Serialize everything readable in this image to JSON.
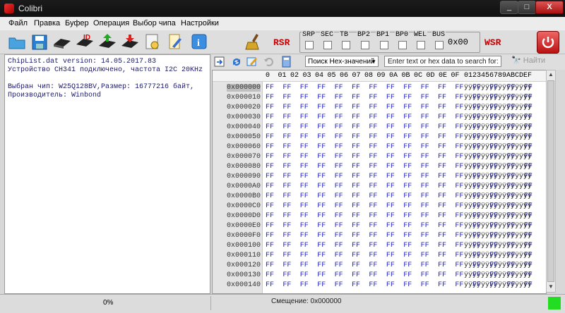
{
  "window": {
    "title": "Colibri",
    "min": "_",
    "max": "□",
    "close": "X"
  },
  "menu": [
    "Файл",
    "Правка",
    "Буфер",
    "Операция",
    "Выбор чипа",
    "Настройки"
  ],
  "registers": {
    "rsr_label": "RSR",
    "wsr_label": "WSR",
    "value": "0x00",
    "bits": [
      "SRP",
      "SEC",
      "TB",
      "BP2",
      "BP1",
      "BP0",
      "WEL",
      "BUS"
    ]
  },
  "log": [
    "ChipList.dat version: 14.05.2017.83",
    "Устройство CH341 подключено, частота I2C 20KHz",
    "",
    "Выбран чип: W25Q128BV,Размер: 16777216 байт,",
    "Производитель: Winbond"
  ],
  "hex_tools": {
    "search_mode": "Поиск Hex-значений",
    "search_placeholder": "Enter text or hex data to search for:",
    "find_label": "Найти"
  },
  "hex_header": {
    "columns": [
      "0",
      "01",
      "02",
      "03",
      "04",
      "05",
      "06",
      "07",
      "08",
      "09",
      "0A",
      "0B",
      "0C",
      "0D",
      "0E",
      "0F"
    ],
    "ascii_header": "0123456789ABCDEF"
  },
  "hex_rows": [
    {
      "addr": "0x000000",
      "bytes": "FF FF FF FF FF FF FF FF FF FF FF FF FF FF FF FF",
      "ascii": "ÿÿÿÿÿÿÿÿÿÿÿÿÿÿÿÿ"
    },
    {
      "addr": "0x000010",
      "bytes": "FF FF FF FF FF FF FF FF FF FF FF FF FF FF FF FF",
      "ascii": "ÿÿÿÿÿÿÿÿÿÿÿÿÿÿÿÿ"
    },
    {
      "addr": "0x000020",
      "bytes": "FF FF FF FF FF FF FF FF FF FF FF FF FF FF FF FF",
      "ascii": "ÿÿÿÿÿÿÿÿÿÿÿÿÿÿÿÿ"
    },
    {
      "addr": "0x000030",
      "bytes": "FF FF FF FF FF FF FF FF FF FF FF FF FF FF FF FF",
      "ascii": "ÿÿÿÿÿÿÿÿÿÿÿÿÿÿÿÿ"
    },
    {
      "addr": "0x000040",
      "bytes": "FF FF FF FF FF FF FF FF FF FF FF FF FF FF FF FF",
      "ascii": "ÿÿÿÿÿÿÿÿÿÿÿÿÿÿÿÿ"
    },
    {
      "addr": "0x000050",
      "bytes": "FF FF FF FF FF FF FF FF FF FF FF FF FF FF FF FF",
      "ascii": "ÿÿÿÿÿÿÿÿÿÿÿÿÿÿÿÿ"
    },
    {
      "addr": "0x000060",
      "bytes": "FF FF FF FF FF FF FF FF FF FF FF FF FF FF FF FF",
      "ascii": "ÿÿÿÿÿÿÿÿÿÿÿÿÿÿÿÿ"
    },
    {
      "addr": "0x000070",
      "bytes": "FF FF FF FF FF FF FF FF FF FF FF FF FF FF FF FF",
      "ascii": "ÿÿÿÿÿÿÿÿÿÿÿÿÿÿÿÿ"
    },
    {
      "addr": "0x000080",
      "bytes": "FF FF FF FF FF FF FF FF FF FF FF FF FF FF FF FF",
      "ascii": "ÿÿÿÿÿÿÿÿÿÿÿÿÿÿÿÿ"
    },
    {
      "addr": "0x000090",
      "bytes": "FF FF FF FF FF FF FF FF FF FF FF FF FF FF FF FF",
      "ascii": "ÿÿÿÿÿÿÿÿÿÿÿÿÿÿÿÿ"
    },
    {
      "addr": "0x0000A0",
      "bytes": "FF FF FF FF FF FF FF FF FF FF FF FF FF FF FF FF",
      "ascii": "ÿÿÿÿÿÿÿÿÿÿÿÿÿÿÿÿ"
    },
    {
      "addr": "0x0000B0",
      "bytes": "FF FF FF FF FF FF FF FF FF FF FF FF FF FF FF FF",
      "ascii": "ÿÿÿÿÿÿÿÿÿÿÿÿÿÿÿÿ"
    },
    {
      "addr": "0x0000C0",
      "bytes": "FF FF FF FF FF FF FF FF FF FF FF FF FF FF FF FF",
      "ascii": "ÿÿÿÿÿÿÿÿÿÿÿÿÿÿÿÿ"
    },
    {
      "addr": "0x0000D0",
      "bytes": "FF FF FF FF FF FF FF FF FF FF FF FF FF FF FF FF",
      "ascii": "ÿÿÿÿÿÿÿÿÿÿÿÿÿÿÿÿ"
    },
    {
      "addr": "0x0000E0",
      "bytes": "FF FF FF FF FF FF FF FF FF FF FF FF FF FF FF FF",
      "ascii": "ÿÿÿÿÿÿÿÿÿÿÿÿÿÿÿÿ"
    },
    {
      "addr": "0x0000F0",
      "bytes": "FF FF FF FF FF FF FF FF FF FF FF FF FF FF FF FF",
      "ascii": "ÿÿÿÿÿÿÿÿÿÿÿÿÿÿÿÿ"
    },
    {
      "addr": "0x000100",
      "bytes": "FF FF FF FF FF FF FF FF FF FF FF FF FF FF FF FF",
      "ascii": "ÿÿÿÿÿÿÿÿÿÿÿÿÿÿÿÿ"
    },
    {
      "addr": "0x000110",
      "bytes": "FF FF FF FF FF FF FF FF FF FF FF FF FF FF FF FF",
      "ascii": "ÿÿÿÿÿÿÿÿÿÿÿÿÿÿÿÿ"
    },
    {
      "addr": "0x000120",
      "bytes": "FF FF FF FF FF FF FF FF FF FF FF FF FF FF FF FF",
      "ascii": "ÿÿÿÿÿÿÿÿÿÿÿÿÿÿÿÿ"
    },
    {
      "addr": "0x000130",
      "bytes": "FF FF FF FF FF FF FF FF FF FF FF FF FF FF FF FF",
      "ascii": "ÿÿÿÿÿÿÿÿÿÿÿÿÿÿÿÿ"
    },
    {
      "addr": "0x000140",
      "bytes": "FF FF FF FF FF FF FF FF FF FF FF FF FF FF FF FF",
      "ascii": "ÿÿÿÿÿÿÿÿÿÿÿÿÿÿÿÿ"
    }
  ],
  "status": {
    "progress": "0%",
    "offset": "Смещение: 0x000000"
  }
}
